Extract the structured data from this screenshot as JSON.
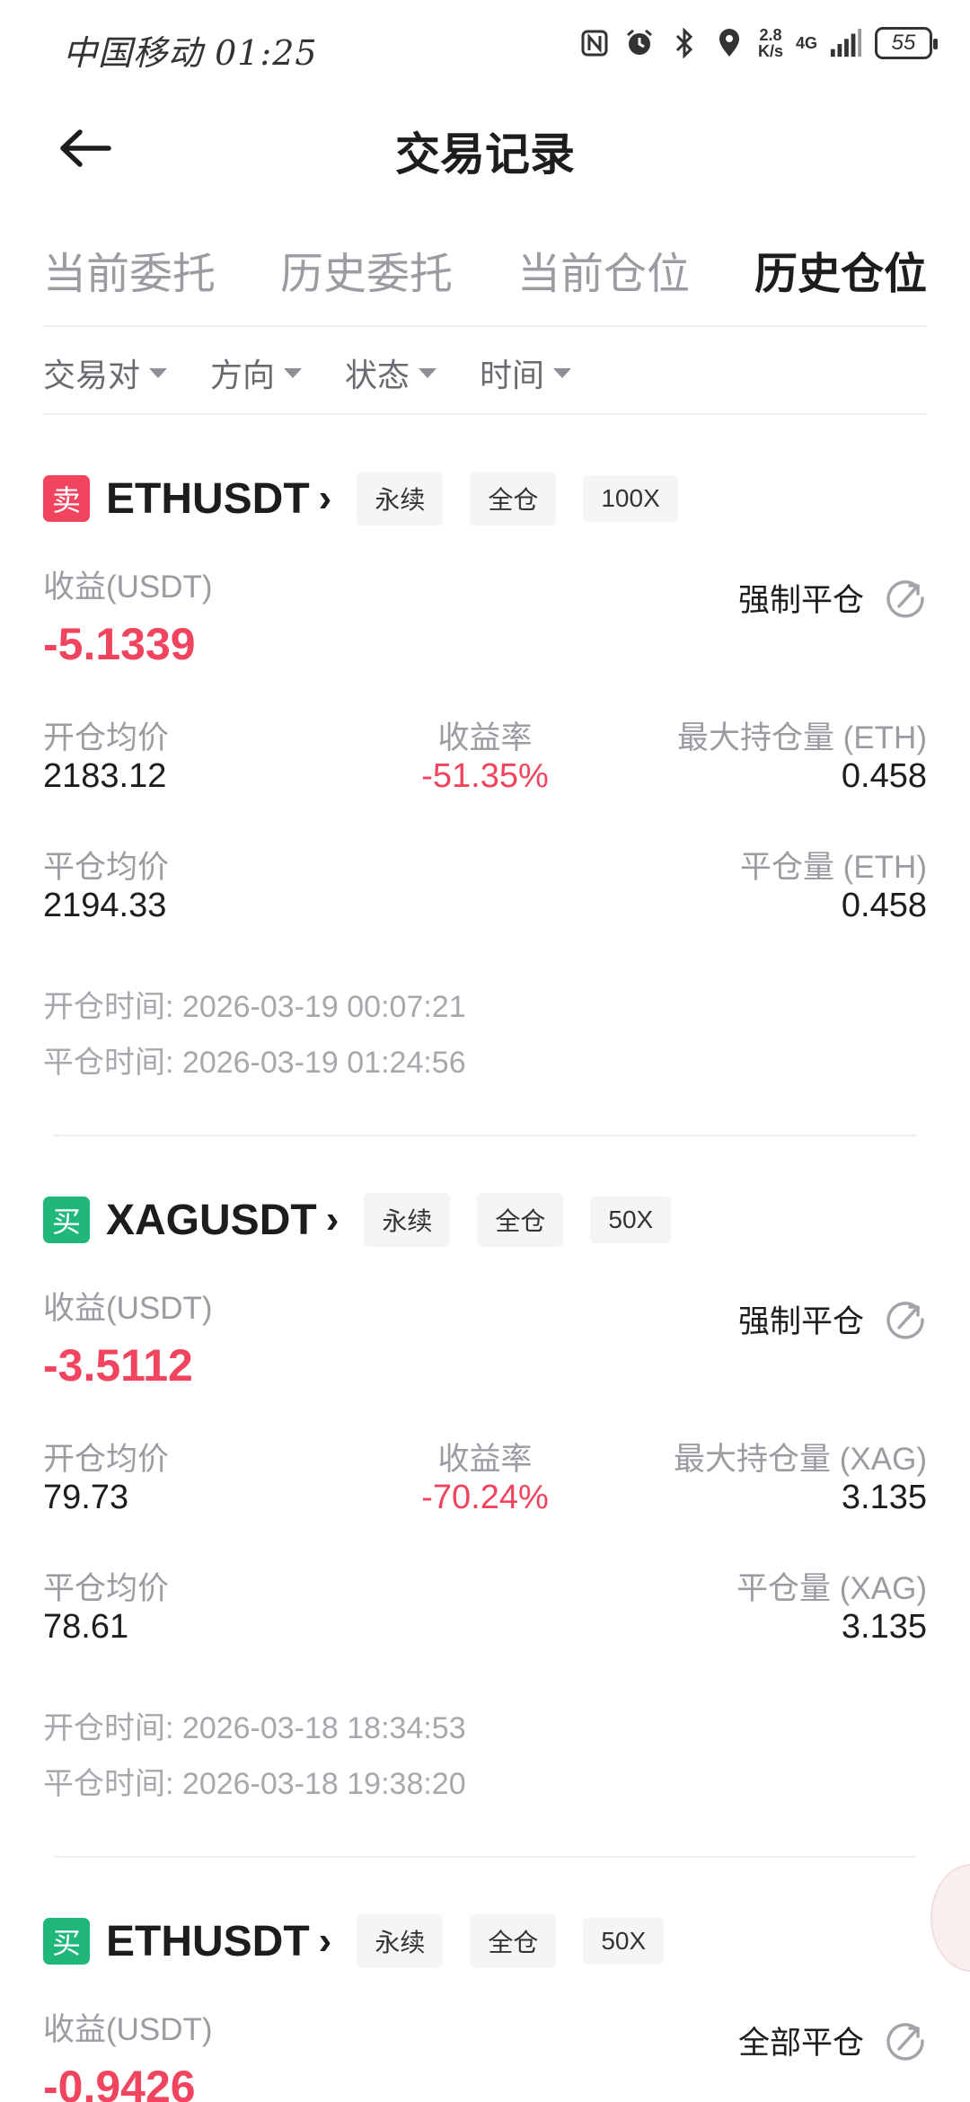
{
  "status_bar": {
    "carrier_time": "中国移动 01:25",
    "speed_top": "2.8",
    "speed_bottom": "K/s",
    "network": "4G",
    "battery": "55"
  },
  "header": {
    "title": "交易记录",
    "back_icon": "arrow-left-icon"
  },
  "tabs": [
    {
      "label": "当前委托",
      "active": false
    },
    {
      "label": "历史委托",
      "active": false
    },
    {
      "label": "当前仓位",
      "active": false
    },
    {
      "label": "历史仓位",
      "active": true
    }
  ],
  "filters": [
    {
      "label": "交易对"
    },
    {
      "label": "方向"
    },
    {
      "label": "状态"
    },
    {
      "label": "时间"
    }
  ],
  "labels": {
    "pnl": "收益(USDT)",
    "open_avg": "开仓均价",
    "roi": "收益率",
    "close_avg": "平仓均价",
    "open_time": "开仓时间:",
    "close_time": "平仓时间:"
  },
  "positions": [
    {
      "side": "卖",
      "side_color": "#f0445f",
      "pair": "ETHUSDT",
      "tags": [
        "永续",
        "全仓",
        "100X"
      ],
      "close_type": "强制平仓",
      "pnl": "-5.1339",
      "open_avg": "2183.12",
      "roi": "-51.35%",
      "max_pos_label": "最大持仓量 (ETH)",
      "max_pos": "0.458",
      "close_avg": "2194.33",
      "close_qty_label": "平仓量 (ETH)",
      "close_qty": "0.458",
      "open_time": "2026-03-19 00:07:21",
      "close_time": "2026-03-19 01:24:56"
    },
    {
      "side": "买",
      "side_color": "#20b87a",
      "pair": "XAGUSDT",
      "tags": [
        "永续",
        "全仓",
        "50X"
      ],
      "close_type": "强制平仓",
      "pnl": "-3.5112",
      "open_avg": "79.73",
      "roi": "-70.24%",
      "max_pos_label": "最大持仓量 (XAG)",
      "max_pos": "3.135",
      "close_avg": "78.61",
      "close_qty_label": "平仓量 (XAG)",
      "close_qty": "3.135",
      "open_time": "2026-03-18 18:34:53",
      "close_time": "2026-03-18 19:38:20"
    },
    {
      "side": "买",
      "side_color": "#20b87a",
      "pair": "ETHUSDT",
      "tags": [
        "永续",
        "全仓",
        "50X"
      ],
      "close_type": "全部平仓",
      "pnl": "-0.9426"
    }
  ]
}
